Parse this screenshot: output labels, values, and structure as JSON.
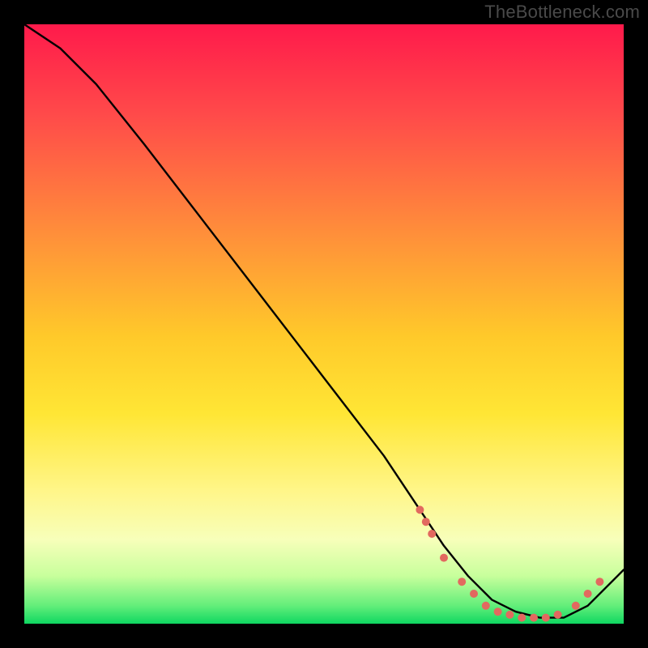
{
  "watermark": "TheBottleneck.com",
  "chart_data": {
    "type": "line",
    "title": "",
    "xlabel": "",
    "ylabel": "",
    "xlim": [
      0,
      100
    ],
    "ylim": [
      0,
      100
    ],
    "series": [
      {
        "name": "bottleneck-curve",
        "x": [
          0,
          6,
          12,
          20,
          30,
          40,
          50,
          60,
          66,
          70,
          74,
          78,
          82,
          86,
          90,
          94,
          100
        ],
        "y": [
          100,
          96,
          90,
          80,
          67,
          54,
          41,
          28,
          19,
          13,
          8,
          4,
          2,
          1,
          1,
          3,
          9
        ]
      }
    ],
    "markers": [
      {
        "x": 66,
        "y": 19
      },
      {
        "x": 67,
        "y": 17
      },
      {
        "x": 68,
        "y": 15
      },
      {
        "x": 70,
        "y": 11
      },
      {
        "x": 73,
        "y": 7
      },
      {
        "x": 75,
        "y": 5
      },
      {
        "x": 77,
        "y": 3
      },
      {
        "x": 79,
        "y": 2
      },
      {
        "x": 81,
        "y": 1.5
      },
      {
        "x": 83,
        "y": 1
      },
      {
        "x": 85,
        "y": 1
      },
      {
        "x": 87,
        "y": 1
      },
      {
        "x": 89,
        "y": 1.5
      },
      {
        "x": 92,
        "y": 3
      },
      {
        "x": 94,
        "y": 5
      },
      {
        "x": 96,
        "y": 7
      }
    ],
    "gradient_stops": [
      {
        "pos": 0,
        "color": "#ff1a4b"
      },
      {
        "pos": 15,
        "color": "#ff4a4a"
      },
      {
        "pos": 35,
        "color": "#ff8f3a"
      },
      {
        "pos": 52,
        "color": "#ffc92a"
      },
      {
        "pos": 65,
        "color": "#ffe635"
      },
      {
        "pos": 78,
        "color": "#fff68a"
      },
      {
        "pos": 86,
        "color": "#f7ffba"
      },
      {
        "pos": 92,
        "color": "#c8ff9c"
      },
      {
        "pos": 97,
        "color": "#63ee7a"
      },
      {
        "pos": 100,
        "color": "#0fd761"
      }
    ],
    "marker_color": "#e2695f",
    "line_color": "#000000"
  }
}
